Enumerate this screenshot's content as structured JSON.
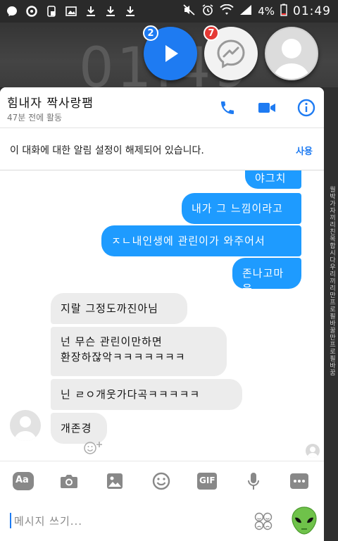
{
  "status_bar": {
    "battery": "4%",
    "time": "01:49"
  },
  "wallpaper": {
    "clock": "01:49"
  },
  "chat_heads": {
    "play_badge": "2",
    "messenger_badge": "7"
  },
  "header": {
    "name": "힘내자 짝사랑팸",
    "status": "47분 전에 활동"
  },
  "notice": {
    "text": "이 대화에 대한 알림 설정이 해제되어 있습니다.",
    "button": "사용"
  },
  "messages": [
    {
      "from": "me",
      "text": "야그치"
    },
    {
      "from": "me",
      "text": "내가 그 느낌이라고"
    },
    {
      "from": "me",
      "text": "ㅈㄴ내인생에 관린이가 와주어서"
    },
    {
      "from": "me",
      "text": "존나고마움"
    },
    {
      "from": "them",
      "text": "지랄 그정도까진아님"
    },
    {
      "from": "them",
      "text": "넌 무슨 관린이만하면"
    },
    {
      "from": "them",
      "text": "환장하잖악ㅋㅋㅋㅋㅋㅋㅋ"
    },
    {
      "from": "them",
      "text": "닌 ㄹㅇ개웃가다곡ㅋㅋㅋㅋㅋ"
    },
    {
      "from": "them",
      "text": "개존경"
    }
  ],
  "toolbar": {
    "aa_label": "Aa",
    "gif_label": "GIF"
  },
  "compose": {
    "placeholder": "메시지 쓰기..."
  },
  "side_strip": {
    "text": "월박가자끼리친목합시다우리끼리만프로필바꿀만프로필바꿈"
  }
}
